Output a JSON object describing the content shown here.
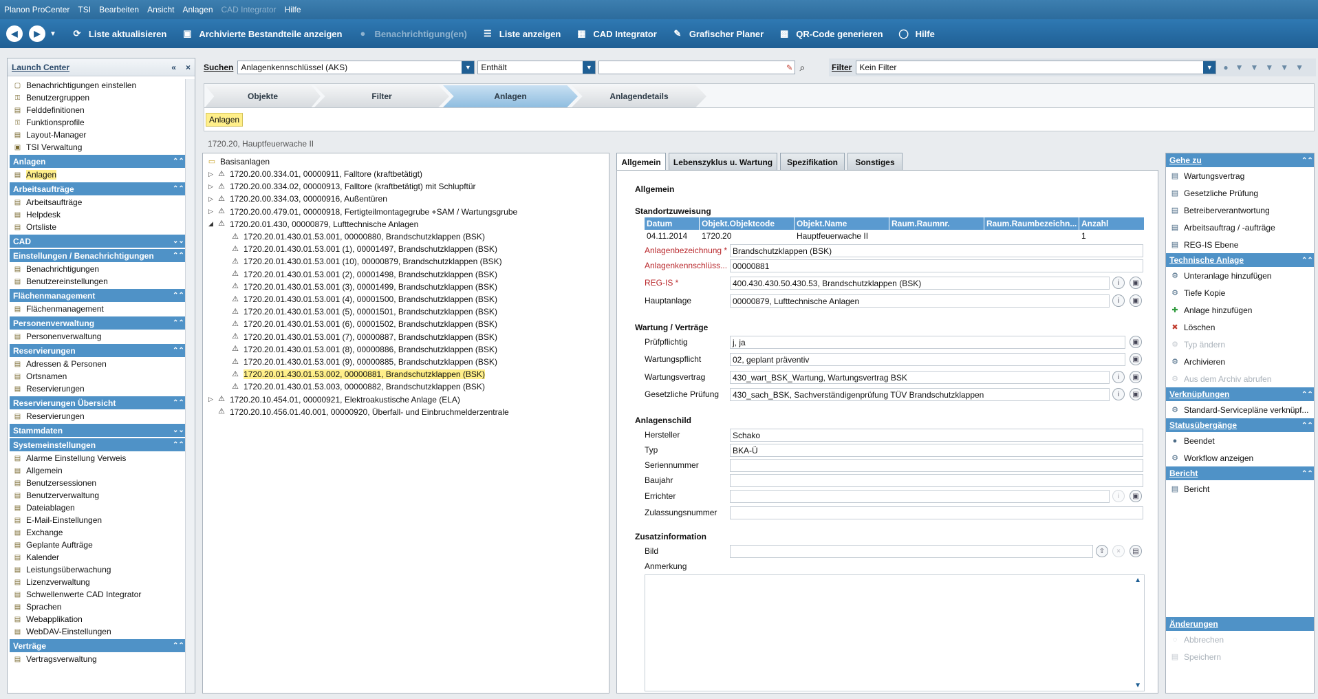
{
  "menubar": {
    "items": [
      "Planon ProCenter",
      "TSI",
      "Bearbeiten",
      "Ansicht",
      "Anlagen",
      "CAD Integrator",
      "Hilfe"
    ]
  },
  "toolbar": {
    "list_refresh": "Liste aktualisieren",
    "archived": "Archivierte Bestandteile anzeigen",
    "notifications": "Benachrichtigung(en)",
    "show_list": "Liste anzeigen",
    "cad": "CAD Integrator",
    "grafik": "Grafischer Planer",
    "qr": "QR-Code generieren",
    "help": "Hilfe"
  },
  "launch": {
    "title": "Launch Center",
    "items_top": [
      "Benachrichtigungen einstellen",
      "Benutzergruppen",
      "Felddefinitionen",
      "Funktionsprofile",
      "Layout-Manager",
      "TSI Verwaltung"
    ],
    "sections": [
      {
        "title": "Anlagen",
        "items": [
          "Anlagen"
        ]
      },
      {
        "title": "Arbeitsaufträge",
        "items": [
          "Arbeitsaufträge",
          "Helpdesk",
          "Ortsliste"
        ]
      },
      {
        "title": "CAD",
        "items": []
      },
      {
        "title": "Einstellungen / Benachrichtigungen",
        "items": [
          "Benachrichtigungen",
          "Benutzereinstellungen"
        ]
      },
      {
        "title": "Flächenmanagement",
        "items": [
          "Flächenmanagement"
        ]
      },
      {
        "title": "Personenverwaltung",
        "items": [
          "Personenverwaltung"
        ]
      },
      {
        "title": "Reservierungen",
        "items": [
          "Adressen & Personen",
          "Ortsnamen",
          "Reservierungen"
        ]
      },
      {
        "title": "Reservierungen Übersicht",
        "items": [
          "Reservierungen"
        ]
      },
      {
        "title": "Stammdaten",
        "items": []
      },
      {
        "title": "Systemeinstellungen",
        "items": [
          "Alarme Einstellung Verweis",
          "Allgemein",
          "Benutzersessionen",
          "Benutzerverwaltung",
          "Dateiablagen",
          "E-Mail-Einstellungen",
          "Exchange",
          "Geplante Aufträge",
          "Kalender",
          "Leistungsüberwachung",
          "Lizenzverwaltung",
          "Schwellenwerte CAD Integrator",
          "Sprachen",
          "Webapplikation",
          "WebDAV-Einstellungen"
        ]
      },
      {
        "title": "Verträge",
        "items": [
          "Vertragsverwaltung"
        ]
      }
    ]
  },
  "search": {
    "label": "Suchen",
    "field": "Anlagenkennschlüssel (AKS)",
    "operator": "Enthält",
    "value": ""
  },
  "filter": {
    "label": "Filter",
    "value": "Kein Filter"
  },
  "crumbs": [
    "Objekte",
    "Filter",
    "Anlagen",
    "Anlagendetails"
  ],
  "subtab": "Anlagen",
  "location": "1720.20, Hauptfeuerwache II",
  "tree": {
    "root": "Basisanlagen",
    "nodes": [
      "1720.20.00.334.01, 00000911, Falltore (kraftbetätigt)",
      "1720.20.00.334.02, 00000913, Falltore (kraftbetätigt) mit Schlupftür",
      "1720.20.00.334.03, 00000916, Außentüren",
      "1720.20.00.479.01, 00000918, Fertigteilmontagegrube +SAM / Wartungsgrube",
      "1720.20.01.430, 00000879, Lufttechnische Anlagen",
      "1720.20.01.430.01.53.001, 00000880, Brandschutzklappen (BSK)",
      "1720.20.01.430.01.53.001 (1), 00001497, Brandschutzklappen (BSK)",
      "1720.20.01.430.01.53.001 (10), 00000879, Brandschutzklappen (BSK)",
      "1720.20.01.430.01.53.001 (2), 00001498, Brandschutzklappen (BSK)",
      "1720.20.01.430.01.53.001 (3), 00001499, Brandschutzklappen (BSK)",
      "1720.20.01.430.01.53.001 (4), 00001500, Brandschutzklappen (BSK)",
      "1720.20.01.430.01.53.001 (5), 00001501, Brandschutzklappen (BSK)",
      "1720.20.01.430.01.53.001 (6), 00001502, Brandschutzklappen (BSK)",
      "1720.20.01.430.01.53.001 (7), 00000887, Brandschutzklappen (BSK)",
      "1720.20.01.430.01.53.001 (8), 00000886, Brandschutzklappen (BSK)",
      "1720.20.01.430.01.53.001 (9), 00000885, Brandschutzklappen (BSK)",
      "1720.20.01.430.01.53.002, 00000881, Brandschutzklappen (BSK)",
      "1720.20.01.430.01.53.003, 00000882, Brandschutzklappen (BSK)",
      "1720.20.10.454.01, 00000921, Elektroakustische Anlage (ELA)",
      "1720.20.10.456.01.40.001, 00000920, Überfall- und Einbruchmelderzentrale"
    ]
  },
  "detail_tabs": [
    "Allgemein",
    "Lebenszyklus u. Wartung",
    "Spezifikation",
    "Sonstiges"
  ],
  "details": {
    "heading": "Allgemein",
    "standort": {
      "title": "Standortzuweisung",
      "columns": [
        "Datum",
        "Objekt.Objektcode",
        "Objekt.Name",
        "Raum.Raumnr.",
        "Raum.Raumbezeichn...",
        "Anzahl"
      ],
      "row": [
        "04.11.2014",
        "1720.20",
        "Hauptfeuerwache II",
        "",
        "",
        "1"
      ]
    },
    "anlagenbezeichnung": {
      "label": "Anlagenbezeichnung *",
      "value": "Brandschutzklappen (BSK)"
    },
    "aks": {
      "label": "Anlagenkennschlüss...",
      "value": "00000881"
    },
    "regis": {
      "label": "REG-IS *",
      "value": "400.430.430.50.430.53, Brandschutzklappen (BSK)"
    },
    "hauptanlage": {
      "label": "Hauptanlage",
      "value": "00000879, Lufttechnische Anlagen"
    },
    "wartung": {
      "title": "Wartung / Verträge",
      "pruef": {
        "label": "Prüfpflichtig",
        "value": "j, ja"
      },
      "wpflicht": {
        "label": "Wartungspflicht",
        "value": "02, geplant präventiv"
      },
      "wvertrag": {
        "label": "Wartungsvertrag",
        "value": "430_wart_BSK_Wartung, Wartungsvertrag BSK"
      },
      "gpruef": {
        "label": "Gesetzliche Prüfung",
        "value": "430_sach_BSK, Sachverständigenprüfung TÜV Brandschutzklappen"
      }
    },
    "schild": {
      "title": "Anlagenschild",
      "hersteller": {
        "label": "Hersteller",
        "value": "Schako"
      },
      "typ": {
        "label": "Typ",
        "value": "BKA-Ü"
      },
      "serien": {
        "label": "Seriennummer",
        "value": ""
      },
      "baujahr": {
        "label": "Baujahr",
        "value": ""
      },
      "errichter": {
        "label": "Errichter",
        "value": ""
      },
      "zulassung": {
        "label": "Zulassungsnummer",
        "value": ""
      }
    },
    "zusatz": {
      "title": "Zusatzinformation",
      "bild": {
        "label": "Bild",
        "value": ""
      },
      "anmerkung": {
        "label": "Anmerkung",
        "value": ""
      }
    }
  },
  "side": {
    "sections": [
      {
        "title": "Gehe zu",
        "items": [
          {
            "label": "Wartungsvertrag",
            "dis": false
          },
          {
            "label": "Gesetzliche Prüfung",
            "dis": false
          },
          {
            "label": "Betreiberverantwortung",
            "dis": false
          },
          {
            "label": "Arbeitsauftrag / -aufträge",
            "dis": false
          },
          {
            "label": "REG-IS Ebene",
            "dis": false
          }
        ]
      },
      {
        "title": "Technische Anlage",
        "items": [
          {
            "label": "Unteranlage hinzufügen",
            "dis": false
          },
          {
            "label": "Tiefe Kopie",
            "dis": false
          },
          {
            "label": "Anlage hinzufügen",
            "dis": false
          },
          {
            "label": "Löschen",
            "dis": false
          },
          {
            "label": "Typ ändern",
            "dis": true
          },
          {
            "label": "Archivieren",
            "dis": false
          },
          {
            "label": "Aus dem Archiv abrufen",
            "dis": true
          }
        ]
      },
      {
        "title": "Verknüpfungen",
        "items": [
          {
            "label": "Standard-Servicepläne verknüpf...",
            "dis": false
          }
        ]
      },
      {
        "title": "Statusübergänge",
        "items": [
          {
            "label": "Beendet",
            "dis": false
          },
          {
            "label": "Workflow anzeigen",
            "dis": false
          }
        ]
      },
      {
        "title": "Bericht",
        "items": [
          {
            "label": "Bericht",
            "dis": false
          }
        ]
      }
    ],
    "aenderungen": {
      "title": "Änderungen",
      "items": [
        "Abbrechen",
        "Speichern"
      ]
    }
  }
}
